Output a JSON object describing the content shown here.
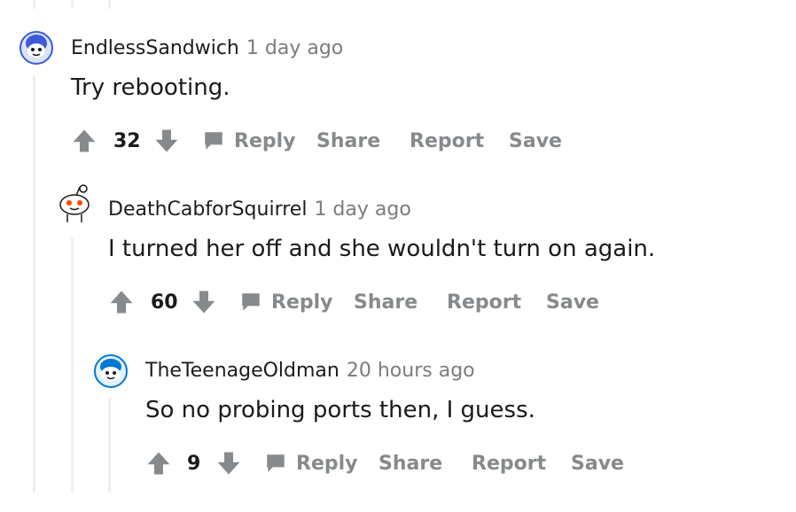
{
  "comments": [
    {
      "author": "EndlessSandwich",
      "time": "1 day ago",
      "text": "Try rebooting.",
      "score": "32",
      "actions": {
        "reply": "Reply",
        "share": "Share",
        "report": "Report",
        "save": "Save"
      },
      "avatar_color": "#3b5bdb"
    },
    {
      "author": "DeathCabforSquirrel",
      "time": "1 day ago",
      "text": "I turned her off and she wouldn't turn on again.",
      "score": "60",
      "actions": {
        "reply": "Reply",
        "share": "Share",
        "report": "Report",
        "save": "Save"
      },
      "avatar_color": "#ff4500"
    },
    {
      "author": "TheTeenageOldman",
      "time": "20 hours ago",
      "text": "So no probing ports then, I guess.",
      "score": "9",
      "actions": {
        "reply": "Reply",
        "share": "Share",
        "report": "Report",
        "save": "Save"
      },
      "avatar_color": "#0079d3"
    }
  ],
  "colors": {
    "thread_line": "#edeff1",
    "action_text": "#878a8c",
    "vote_icon": "#878a8c"
  }
}
